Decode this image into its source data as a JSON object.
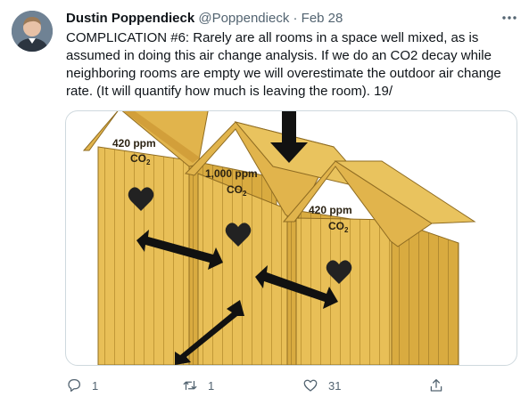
{
  "tweet": {
    "author_name": "Dustin Poppendieck",
    "handle": "@Poppendieck",
    "separator": "·",
    "date": "Feb 28",
    "text": "COMPLICATION #6:  Rarely are all rooms in a space well mixed, as is assumed in doing this air change analysis.  If we do an CO2 decay while neighboring rooms are empty we will overestimate the outdoor air change rate. (It will quantify how much is leaving the room).  19/",
    "replies": "1",
    "retweets": "1",
    "likes": "31"
  },
  "image": {
    "rooms": [
      {
        "ppm": "420 ppm",
        "co2": "CO",
        "sub": "2"
      },
      {
        "ppm": "1,000 ppm",
        "co2": "CO",
        "sub": "2"
      },
      {
        "ppm": "420 ppm",
        "co2": "CO",
        "sub": "2"
      }
    ]
  },
  "icons": {
    "avatar": "avatar",
    "more": "more-icon",
    "reply": "reply-icon",
    "retweet": "retweet-icon",
    "like": "heart-icon",
    "share": "share-icon"
  },
  "colors": {
    "text": "#0f1419",
    "secondary": "#536471",
    "wood": "#e8bf57",
    "wood_dark": "#a9822b",
    "arrow": "#111111"
  }
}
